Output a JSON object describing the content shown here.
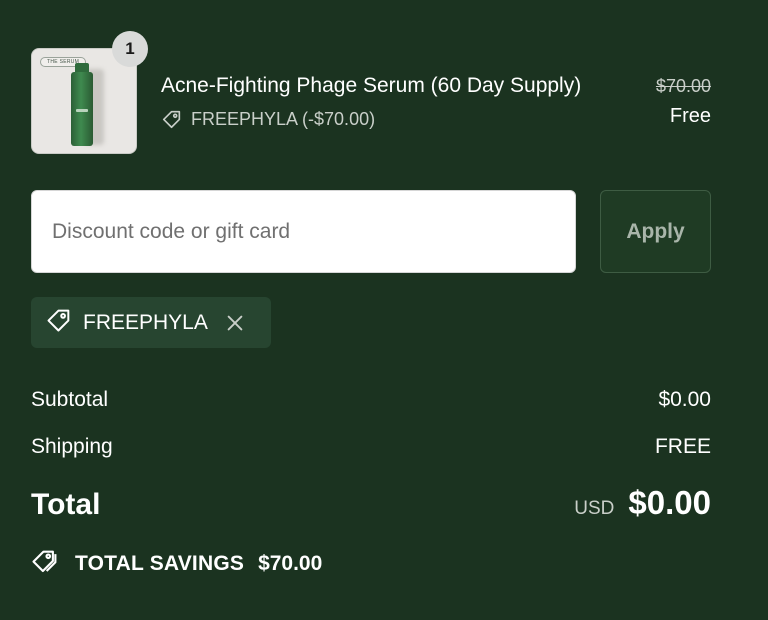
{
  "line_item": {
    "quantity": "1",
    "thumbnail_tag": "THE SERUM",
    "title": "Acne-Fighting Phage Serum (60 Day Supply)",
    "discount_text": "FREEPHYLA (-$70.00)",
    "original_price": "$70.00",
    "final_price": "Free"
  },
  "discount_form": {
    "placeholder": "Discount code or gift card",
    "value": "",
    "apply_label": "Apply"
  },
  "applied_code": {
    "label": "FREEPHYLA",
    "remove_icon": "close-icon"
  },
  "totals": {
    "subtotal_label": "Subtotal",
    "subtotal_value": "$0.00",
    "shipping_label": "Shipping",
    "shipping_value": "FREE",
    "total_label": "Total",
    "currency": "USD",
    "total_value": "$0.00",
    "savings_label": "TOTAL SAVINGS",
    "savings_value": "$70.00"
  },
  "colors": {
    "background": "#1b3320",
    "chip_background": "#274530",
    "text_primary": "#ffffff",
    "text_muted": "#c9cfc9"
  }
}
